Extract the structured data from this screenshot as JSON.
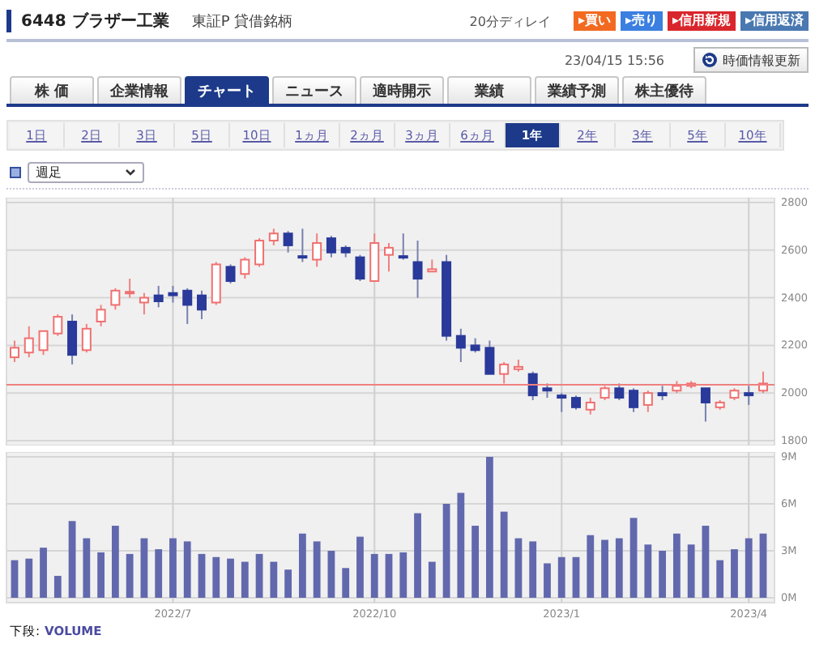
{
  "header": {
    "title": "6448 ブラザー工業",
    "market": "東証P 貸借銘柄",
    "delay": "20分ディレイ",
    "buttons": [
      {
        "label": "▸買い",
        "color": "#f26a21"
      },
      {
        "label": "▸売り",
        "color": "#3b7fe0"
      },
      {
        "label": "▸信用新規",
        "color": "#d9262c"
      },
      {
        "label": "▸信用返済",
        "color": "#4a78b0"
      }
    ]
  },
  "timestamp": "23/04/15 15:56",
  "refresh_button": "時価情報更新",
  "tabs": [
    {
      "label": "株 価",
      "selected": false
    },
    {
      "label": "企業情報",
      "selected": false
    },
    {
      "label": "チャート",
      "selected": true
    },
    {
      "label": "ニュース",
      "selected": false
    },
    {
      "label": "適時開示",
      "selected": false
    },
    {
      "label": "業績",
      "selected": false
    },
    {
      "label": "業績予測",
      "selected": false
    },
    {
      "label": "株主優待",
      "selected": false
    }
  ],
  "periods": [
    {
      "label": "1日",
      "selected": false
    },
    {
      "label": "2日",
      "selected": false
    },
    {
      "label": "3日",
      "selected": false
    },
    {
      "label": "5日",
      "selected": false
    },
    {
      "label": "10日",
      "selected": false
    },
    {
      "label": "1ヵ月",
      "selected": false
    },
    {
      "label": "2ヵ月",
      "selected": false
    },
    {
      "label": "3ヵ月",
      "selected": false
    },
    {
      "label": "6ヵ月",
      "selected": false
    },
    {
      "label": "1年",
      "selected": true
    },
    {
      "label": "2年",
      "selected": false
    },
    {
      "label": "3年",
      "selected": false
    },
    {
      "label": "5年",
      "selected": false
    },
    {
      "label": "10年",
      "selected": false
    }
  ],
  "interval_select": {
    "value": "週足"
  },
  "price_chart": {
    "chart_data": {
      "type": "candlestick",
      "categories": [
        null,
        null,
        null,
        null,
        null,
        null,
        null,
        null,
        null,
        null,
        null,
        null,
        null,
        null,
        null,
        null,
        null,
        null,
        null,
        null,
        null,
        null,
        null,
        null,
        null,
        null,
        null,
        null,
        null,
        null,
        null,
        null,
        null,
        null,
        null,
        null,
        null,
        null,
        null,
        null,
        null,
        null,
        null,
        null,
        null,
        null,
        null,
        null,
        null,
        null,
        null,
        null,
        null
      ],
      "ohlc": [
        [
          2150,
          2220,
          2130,
          2190
        ],
        [
          2170,
          2280,
          2150,
          2230
        ],
        [
          2180,
          2260,
          2160,
          2260
        ],
        [
          2250,
          2330,
          2240,
          2320
        ],
        [
          2300,
          2330,
          2120,
          2160
        ],
        [
          2180,
          2290,
          2170,
          2270
        ],
        [
          2300,
          2370,
          2280,
          2350
        ],
        [
          2370,
          2440,
          2350,
          2430
        ],
        [
          2420,
          2480,
          2400,
          2425
        ],
        [
          2380,
          2420,
          2330,
          2400
        ],
        [
          2410,
          2450,
          2360,
          2385
        ],
        [
          2420,
          2450,
          2380,
          2410
        ],
        [
          2430,
          2440,
          2290,
          2370
        ],
        [
          2410,
          2430,
          2310,
          2350
        ],
        [
          2380,
          2550,
          2370,
          2540
        ],
        [
          2530,
          2540,
          2460,
          2470
        ],
        [
          2500,
          2570,
          2480,
          2560
        ],
        [
          2540,
          2650,
          2530,
          2640
        ],
        [
          2640,
          2690,
          2620,
          2670
        ],
        [
          2670,
          2680,
          2590,
          2620
        ],
        [
          2575,
          2690,
          2550,
          2570
        ],
        [
          2560,
          2670,
          2530,
          2630
        ],
        [
          2650,
          2660,
          2570,
          2590
        ],
        [
          2610,
          2620,
          2570,
          2590
        ],
        [
          2570,
          2580,
          2470,
          2480
        ],
        [
          2470,
          2670,
          2470,
          2630
        ],
        [
          2580,
          2630,
          2510,
          2610
        ],
        [
          2575,
          2670,
          2560,
          2570
        ],
        [
          2550,
          2640,
          2400,
          2480
        ],
        [
          2510,
          2560,
          2510,
          2520
        ],
        [
          2550,
          2580,
          2220,
          2240
        ],
        [
          2240,
          2270,
          2130,
          2190
        ],
        [
          2200,
          2230,
          2170,
          2180
        ],
        [
          2190,
          2220,
          2080,
          2080
        ],
        [
          2080,
          2130,
          2040,
          2120
        ],
        [
          2100,
          2140,
          2090,
          2110
        ],
        [
          2080,
          2090,
          1970,
          1990
        ],
        [
          2020,
          2040,
          1980,
          2010
        ],
        [
          1990,
          2000,
          1920,
          1980
        ],
        [
          1980,
          1990,
          1930,
          1940
        ],
        [
          1930,
          1980,
          1910,
          1960
        ],
        [
          1980,
          2030,
          1970,
          2020
        ],
        [
          2020,
          2040,
          1970,
          1980
        ],
        [
          2010,
          2020,
          1920,
          1940
        ],
        [
          1950,
          2010,
          1920,
          2000
        ],
        [
          2000,
          2030,
          1970,
          1990
        ],
        [
          2010,
          2050,
          2000,
          2030
        ],
        [
          2030,
          2050,
          2020,
          2040
        ],
        [
          2020,
          2020,
          1880,
          1960
        ],
        [
          1940,
          1970,
          1930,
          1960
        ],
        [
          1980,
          2020,
          1970,
          2010
        ],
        [
          2000,
          2030,
          1950,
          1990
        ],
        [
          2010,
          2090,
          2000,
          2040
        ]
      ],
      "ylim": [
        1800,
        2800
      ],
      "yticks": [
        2800,
        2600,
        2400,
        2200,
        2000,
        1800
      ],
      "grid": true
    }
  },
  "volume_chart": {
    "chart_data": {
      "type": "bar",
      "color": "#6268ad",
      "values": [
        2.4,
        2.5,
        3.2,
        1.4,
        4.9,
        3.8,
        2.9,
        4.6,
        2.8,
        3.8,
        3.1,
        3.8,
        3.6,
        2.8,
        2.6,
        2.5,
        2.3,
        2.8,
        2.3,
        1.8,
        4.1,
        3.6,
        3.0,
        1.9,
        3.9,
        2.8,
        2.8,
        2.9,
        5.4,
        2.3,
        6.0,
        6.7,
        4.6,
        9.0,
        5.5,
        3.8,
        3.6,
        2.2,
        2.6,
        2.6,
        4.0,
        3.7,
        3.8,
        5.1,
        3.4,
        3.0,
        4.1,
        3.4,
        4.6,
        2.4,
        3.1,
        3.8,
        4.1
      ],
      "ylim": [
        0,
        9
      ],
      "grid": true,
      "yticks": [
        {
          "value": 9,
          "label": "9M"
        },
        {
          "value": 6,
          "label": "6M"
        },
        {
          "value": 3,
          "label": "3M"
        },
        {
          "value": 0,
          "label": "0M"
        }
      ],
      "categories": [
        null,
        null,
        null,
        null,
        null,
        null,
        null,
        null,
        null,
        null,
        null,
        "2022/7",
        null,
        null,
        null,
        null,
        null,
        null,
        null,
        null,
        null,
        null,
        null,
        null,
        null,
        "2022/10",
        null,
        null,
        null,
        null,
        null,
        null,
        null,
        null,
        null,
        null,
        null,
        null,
        "2023/1",
        null,
        null,
        null,
        null,
        null,
        null,
        null,
        null,
        null,
        null,
        null,
        null,
        "2023/4",
        null
      ]
    }
  },
  "footer": {
    "label": "下段:",
    "link": "VOLUME"
  }
}
